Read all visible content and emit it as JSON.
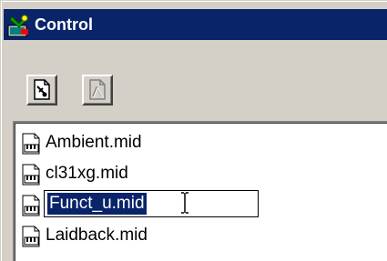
{
  "window": {
    "title": "Control",
    "title_bar_color": "#0a246a",
    "title_icon": "control-panel-icon"
  },
  "toolbar": {
    "buttons": [
      {
        "icon": "properties-icon",
        "enabled": true
      },
      {
        "icon": "disabled-document-icon",
        "enabled": false
      }
    ]
  },
  "file_list": {
    "items": [
      {
        "label": "Ambient.mid",
        "icon": "midi-file-icon",
        "selected": false
      },
      {
        "label": "cl31xg.mid",
        "icon": "midi-file-icon",
        "selected": false
      },
      {
        "label": "Funct_u.mid",
        "icon": "midi-file-icon",
        "selected": true,
        "renaming": true
      },
      {
        "label": "Laidback.mid",
        "icon": "midi-file-icon",
        "selected": false
      }
    ],
    "selection_color": "#0a246a"
  }
}
